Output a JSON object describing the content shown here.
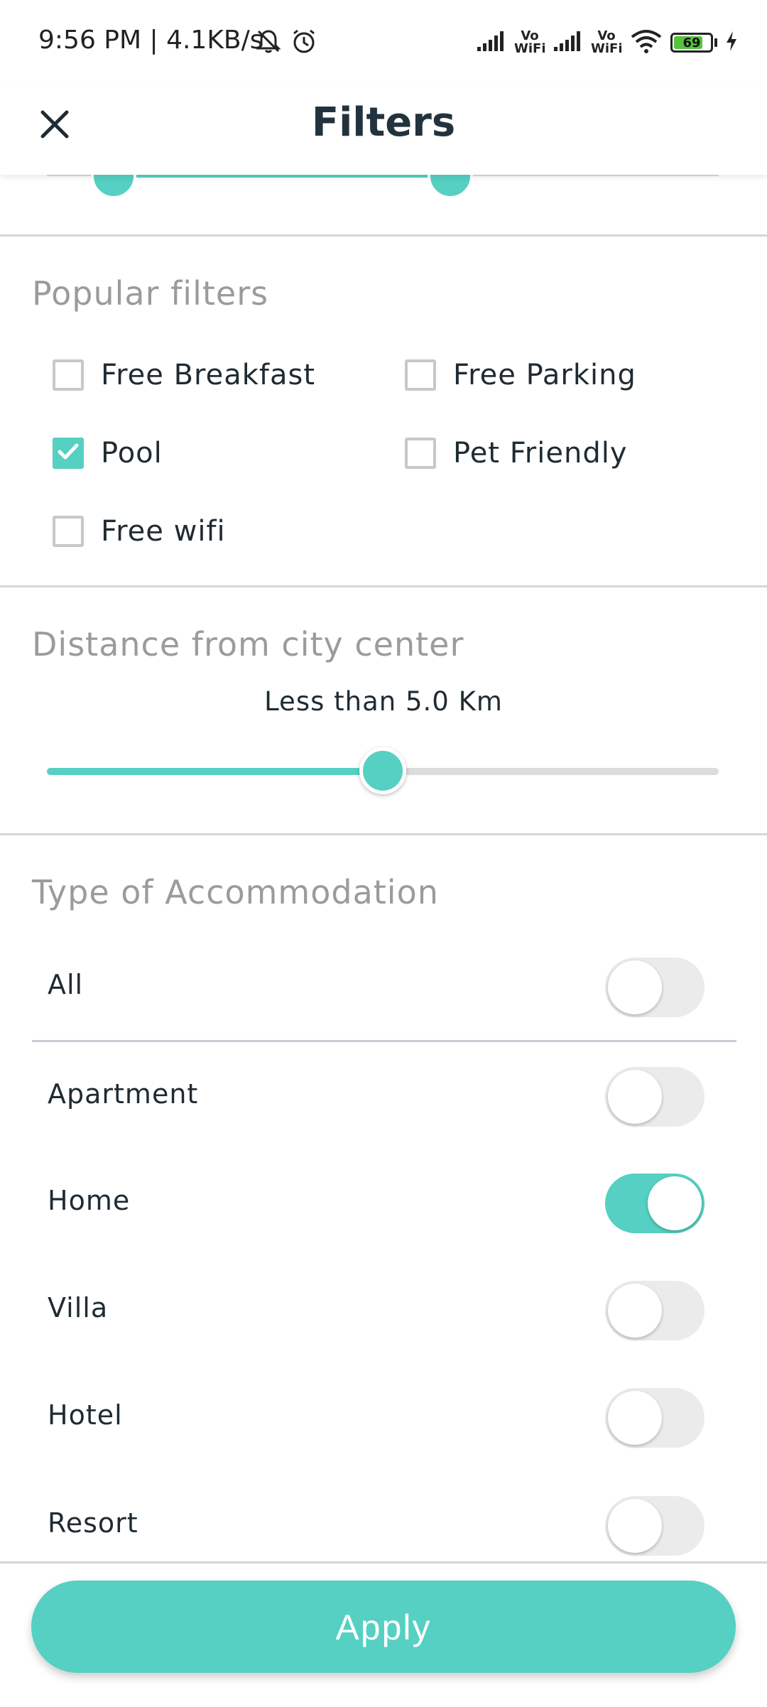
{
  "status_bar": {
    "left_text": "9:56 PM | 4.1KB/s",
    "icons_left": [
      "mute-bell-icon",
      "alarm-icon"
    ],
    "vowifi_1": "Vo WiFi",
    "vowifi_2": "Vo WiFi",
    "battery_level": "69",
    "battery_color": "#55c43c"
  },
  "header": {
    "title": "Filters",
    "close_icon": "close-icon"
  },
  "accent_color": "#55d0c2",
  "popular_filters": {
    "title": "Popular filters",
    "items": [
      {
        "label": "Free Breakfast",
        "checked": false
      },
      {
        "label": "Free Parking",
        "checked": false
      },
      {
        "label": "Pool",
        "checked": true
      },
      {
        "label": "Pet Friendly",
        "checked": false
      },
      {
        "label": "Free wifi",
        "checked": false
      }
    ]
  },
  "distance": {
    "title": "Distance from city center",
    "value_text": "Less than 5.0 Km",
    "slider_fraction": 0.5
  },
  "accommodation": {
    "title": "Type of Accommodation",
    "items": [
      {
        "label": "All",
        "on": false
      },
      {
        "label": "Apartment",
        "on": false
      },
      {
        "label": "Home",
        "on": true
      },
      {
        "label": "Villa",
        "on": false
      },
      {
        "label": "Hotel",
        "on": false
      },
      {
        "label": "Resort",
        "on": false
      }
    ]
  },
  "apply_label": "Apply"
}
